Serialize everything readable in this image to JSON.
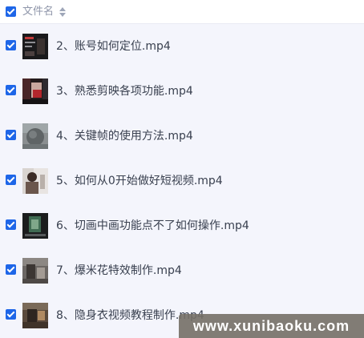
{
  "header": {
    "column_label": "文件名",
    "sort_icon": "sort-icon",
    "select_all_checked": true
  },
  "files": [
    {
      "name": "2、账号如何定位.mp4",
      "checked": true,
      "thumbnail": "video-thumbnail"
    },
    {
      "name": "3、熟悉剪映各项功能.mp4",
      "checked": true,
      "thumbnail": "video-thumbnail"
    },
    {
      "name": "4、关键帧的使用方法.mp4",
      "checked": true,
      "thumbnail": "video-thumbnail"
    },
    {
      "name": "5、如何从0开始做好短视频.mp4",
      "checked": true,
      "thumbnail": "video-thumbnail"
    },
    {
      "name": "6、切画中画功能点不了如何操作.mp4",
      "checked": true,
      "thumbnail": "video-thumbnail"
    },
    {
      "name": "7、爆米花特效制作.mp4",
      "checked": true,
      "thumbnail": "video-thumbnail"
    },
    {
      "name": "8、隐身衣视频教程制作.mp4",
      "checked": true,
      "thumbnail": "video-thumbnail"
    }
  ],
  "watermark": {
    "text": "www.xunibaoku.com"
  },
  "colors": {
    "accent": "#1e66e8",
    "list_background": "#f4f5fc",
    "header_text": "#8f96aa",
    "row_text": "#39404f"
  }
}
